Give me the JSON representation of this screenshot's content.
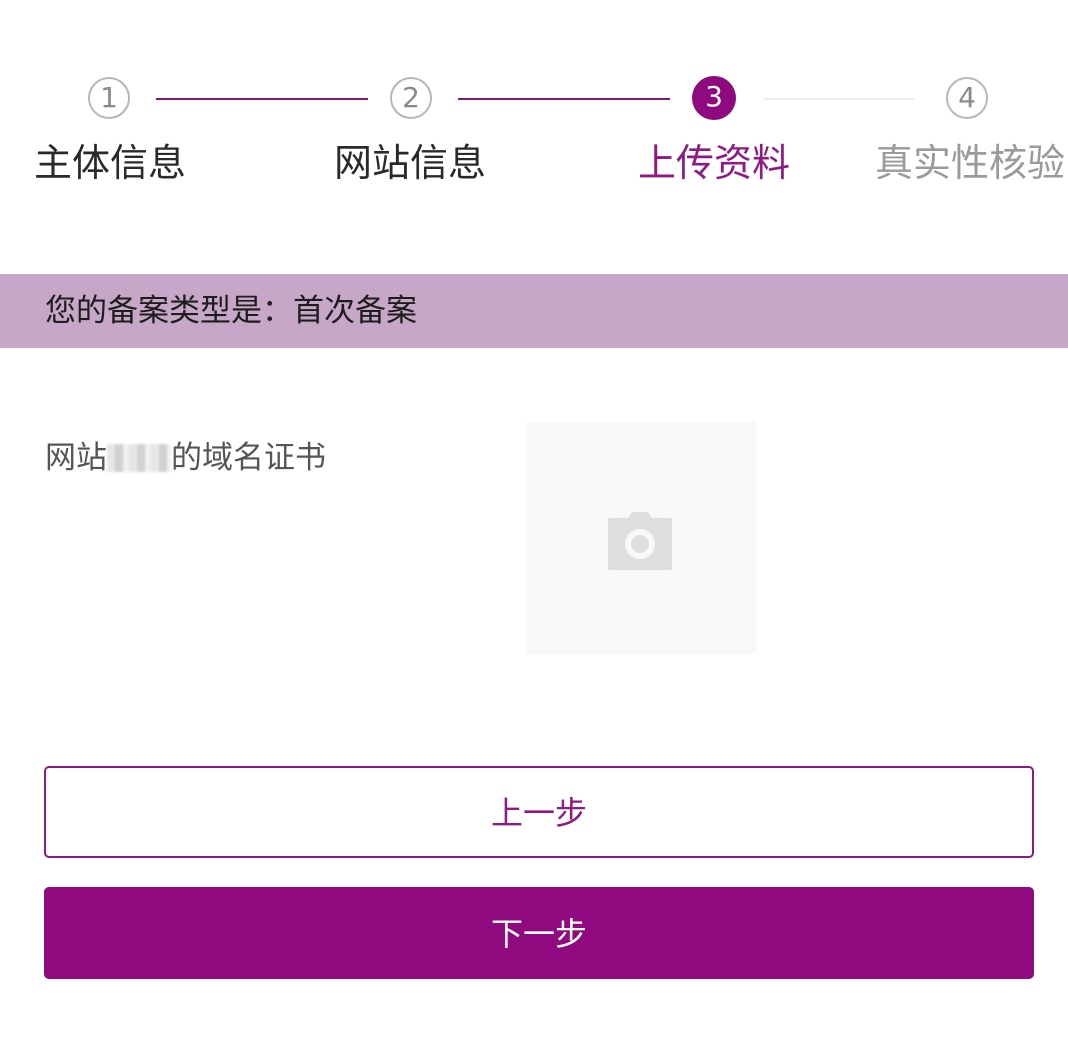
{
  "stepper": {
    "steps": [
      {
        "number": "1",
        "label": "主体信息"
      },
      {
        "number": "2",
        "label": "网站信息"
      },
      {
        "number": "3",
        "label": "上传资料"
      },
      {
        "number": "4",
        "label": "真实性核验"
      }
    ],
    "current_step": 3
  },
  "banner": {
    "text": "您的备案类型是：首次备案"
  },
  "upload": {
    "label_prefix": "网站",
    "label_suffix": "的域名证书",
    "icon": "camera-icon"
  },
  "buttons": {
    "prev_label": "上一步",
    "next_label": "下一步"
  },
  "colors": {
    "accent": "#8e0a7e",
    "banner_bg": "#c7a7c8"
  }
}
